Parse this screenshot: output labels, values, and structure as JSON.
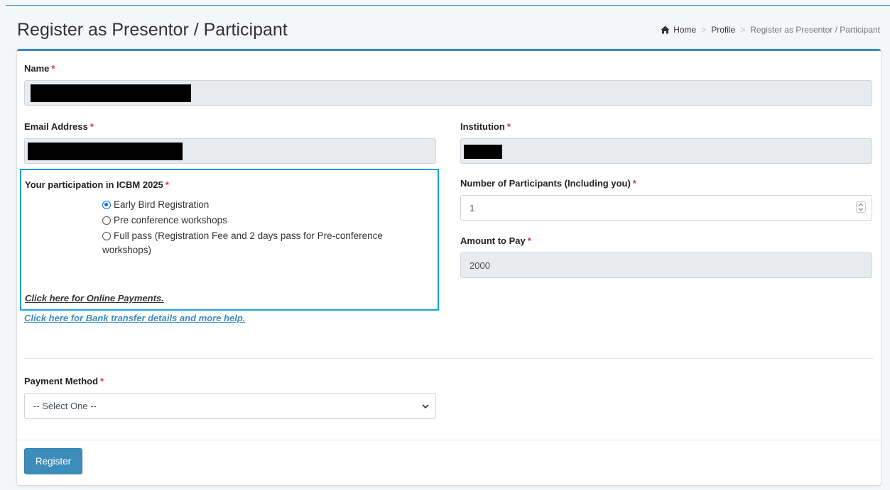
{
  "header": {
    "title": "Register as Presentor / Participant",
    "breadcrumb": {
      "home": "Home",
      "profile": "Profile",
      "current": "Register as Presentor / Participant",
      "separator": ">"
    }
  },
  "form": {
    "name": {
      "label": "Name",
      "value": ""
    },
    "email": {
      "label": "Email Address",
      "value": ""
    },
    "institution": {
      "label": "Institution",
      "value": ""
    },
    "participation": {
      "label": "Your participation in ICBM 2025",
      "options": [
        {
          "label": "Early Bird Registration",
          "selected": true
        },
        {
          "label": "Pre conference workshops",
          "selected": false
        },
        {
          "label": "Full pass (Registration Fee and 2 days pass for Pre-conference",
          "label_line2": "workshops)",
          "selected": false
        }
      ],
      "online_payment_link": "Click here for Online Payments.",
      "bank_transfer_link": "Click here for Bank transfer details and more help."
    },
    "participants": {
      "label": "Number of Participants (Including you)",
      "value": "1"
    },
    "amount": {
      "label": "Amount to Pay",
      "value": "2000"
    },
    "payment_method": {
      "label": "Payment Method",
      "selected": "-- Select One --"
    },
    "required_mark": "*",
    "register_label": "Register"
  },
  "colors": {
    "accent": "#3c8dbc",
    "required": "#dc3545",
    "highlight_border": "#17a2d8",
    "link": "#3c8dbc"
  },
  "icons": {
    "home": "home-icon",
    "select": "chevron-down-icon",
    "spinner": "stepper-icon"
  }
}
